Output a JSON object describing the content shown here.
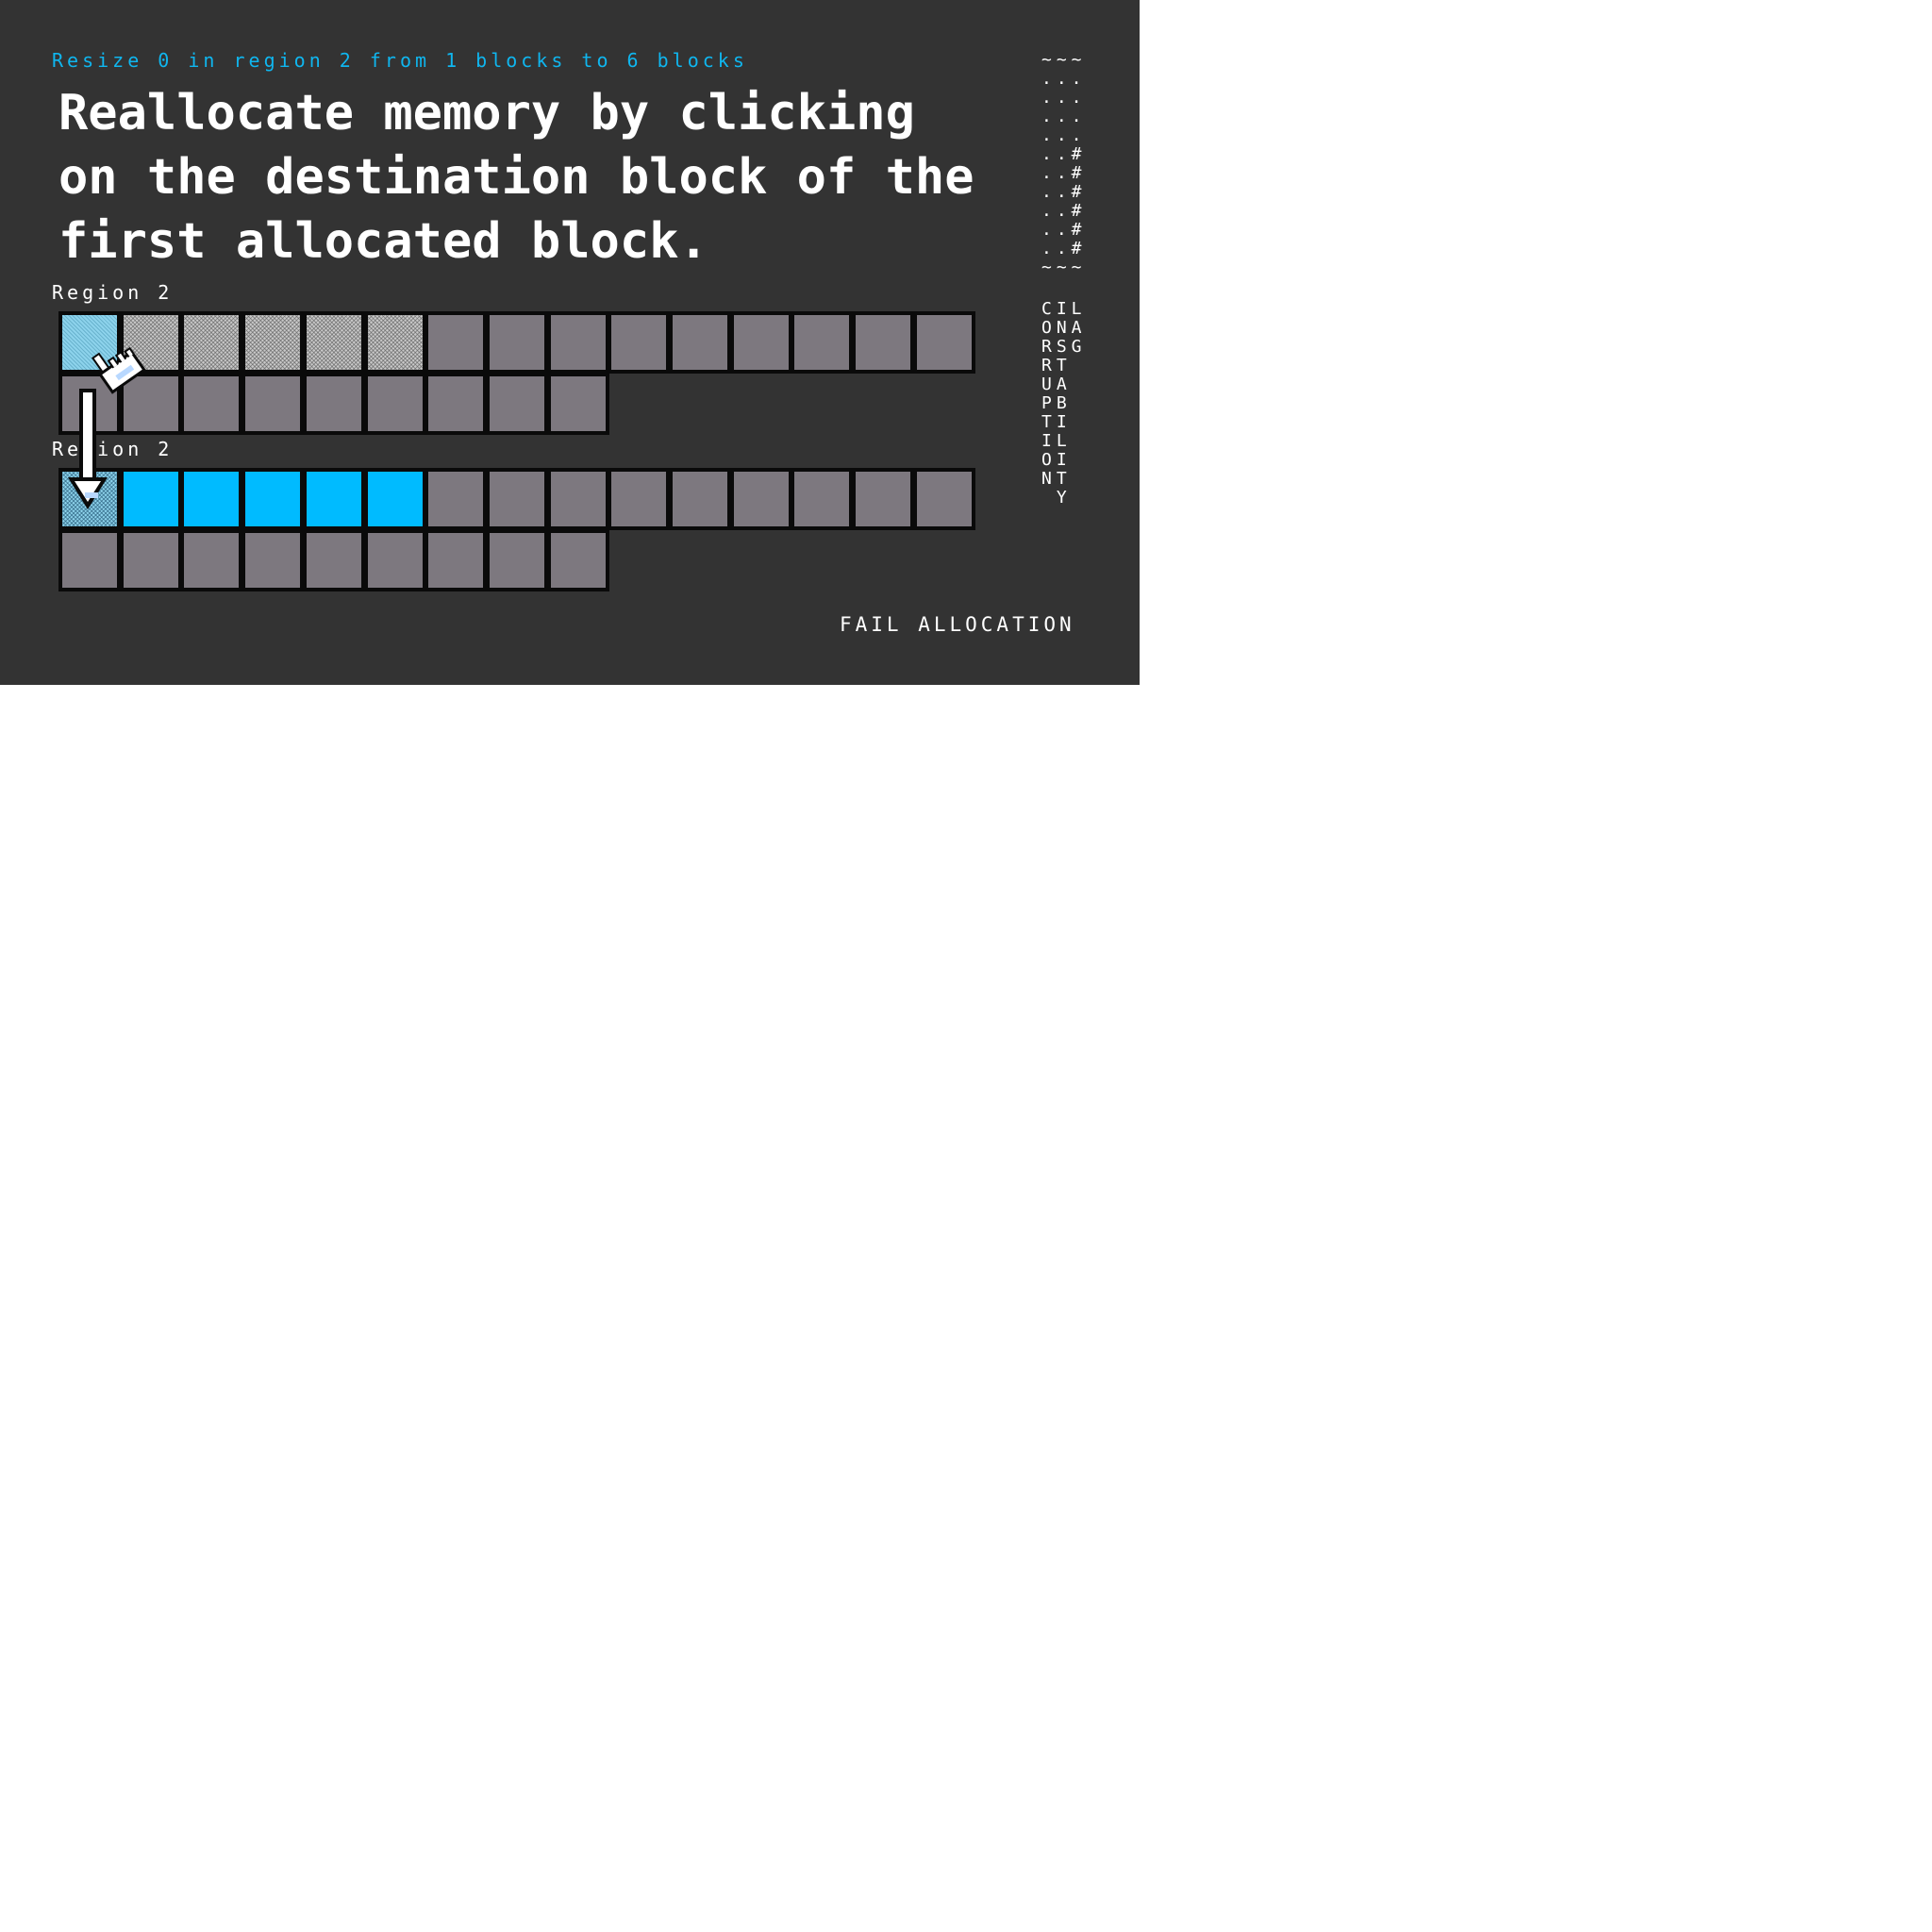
{
  "task": {
    "description": "Resize 0 in region 2 from 1 blocks to 6 blocks",
    "instruction": "Reallocate memory by clicking on the destination block of the first allocated block."
  },
  "regions": [
    {
      "label": "Region 2",
      "blocks_per_row": 15,
      "total_blocks": 24,
      "blocks": [
        "source",
        "hatched",
        "hatched",
        "hatched",
        "hatched",
        "hatched",
        "free",
        "free",
        "free",
        "free",
        "free",
        "free",
        "free",
        "free",
        "free",
        "free",
        "free",
        "free",
        "free",
        "free",
        "free",
        "free",
        "free",
        "free"
      ]
    },
    {
      "label": "Region 2",
      "blocks_per_row": 15,
      "total_blocks": 24,
      "blocks": [
        "target",
        "alloc",
        "alloc",
        "alloc",
        "alloc",
        "alloc",
        "free",
        "free",
        "free",
        "free",
        "free",
        "free",
        "free",
        "free",
        "free",
        "free",
        "free",
        "free",
        "free",
        "free",
        "free",
        "free",
        "free",
        "free"
      ]
    }
  ],
  "block_colors": {
    "free": "#7d787f",
    "allocated": "#00bbff",
    "background": "#333333",
    "accent_text": "#0fb6ef"
  },
  "side_panel": {
    "meter_rows": [
      "~~~",
      "...",
      "...",
      "...",
      "...",
      "..#",
      "..#",
      "..#",
      "..#",
      "..#",
      "..#",
      "~~~"
    ],
    "vertical_rows": [
      "CIL",
      "ONA",
      "RSG",
      "RT",
      "UA",
      "PB",
      "TI",
      "IL",
      "OI",
      "NT",
      " Y"
    ]
  },
  "fail_button": {
    "label": "FAIL ALLOCATION"
  },
  "icons": {
    "cursor": "pointing-hand-cursor-icon",
    "arrow": "down-arrow-icon"
  }
}
